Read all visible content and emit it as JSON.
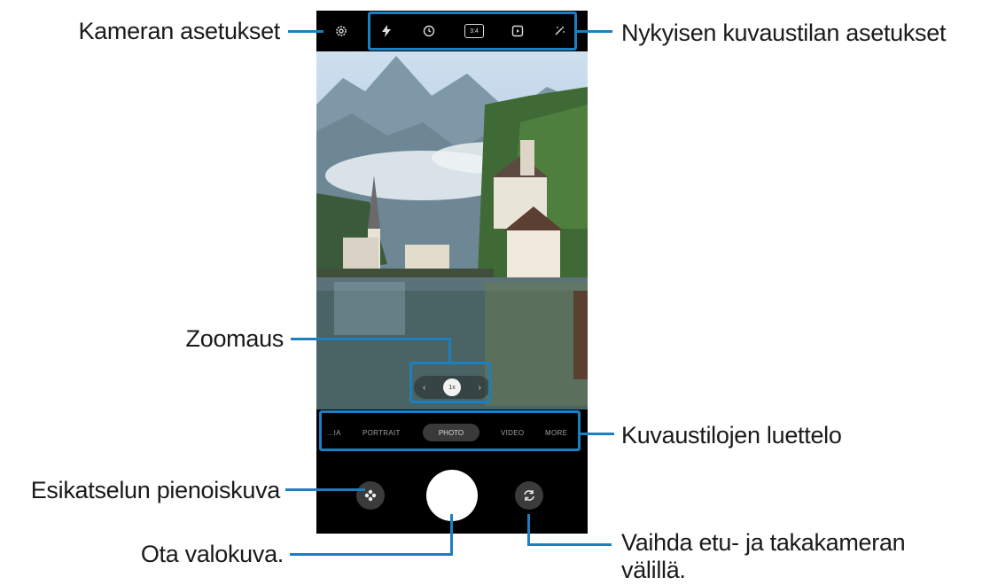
{
  "callouts": {
    "camera_settings": "Kameran asetukset",
    "mode_settings": "Nykyisen kuvaustilan asetukset",
    "zoom": "Zoomaus",
    "modes_list": "Kuvaustilojen luettelo",
    "preview_thumbnail": "Esikatselun pienoiskuva",
    "take_photo": "Ota valokuva.",
    "switch_camera_line1": "Vaihda etu- ja takakameran",
    "switch_camera_line2": "välillä."
  },
  "camera_ui": {
    "top_icons": [
      "gear-icon",
      "flash-icon",
      "timer-icon",
      "ratio-icon",
      "motion-photo-icon",
      "effects-icon"
    ],
    "ratio_label": "3:4",
    "zoom_label": "1x",
    "modes": [
      "...IA",
      "PORTRAIT",
      "PHOTO",
      "VIDEO",
      "MORE"
    ],
    "active_mode": "PHOTO"
  },
  "colors": {
    "accent": "#1c7fbf"
  }
}
